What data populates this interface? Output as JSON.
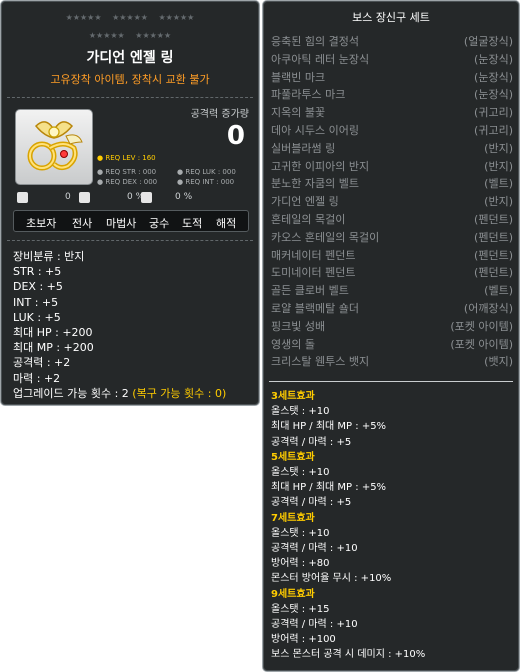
{
  "item": {
    "stars_row1": [
      "★★★★★",
      "★★★★★",
      "★★★★★"
    ],
    "stars_row2": [
      "★★★★★",
      "★★★★★"
    ],
    "name": "가디언 엔젤 링",
    "description": "고유장착 아이템, 장착시 교환 불가",
    "attack_label": "공격력 증가량",
    "attack_value": "0",
    "req_lev": "● REQ LEV : 160",
    "req_str": "● REQ STR : 000",
    "req_luk": "● REQ LUK : 000",
    "req_dex": "● REQ DEX : 000",
    "req_int": "● REQ INT : 000",
    "flags": [
      "0",
      "0 %",
      "0 %"
    ],
    "jobs": [
      "초보자",
      "전사",
      "마법사",
      "궁수",
      "도적",
      "해적"
    ],
    "stats": [
      "장비분류 : 반지",
      "STR : +5",
      "DEX : +5",
      "INT : +5",
      "LUK : +5",
      "최대 HP : +200",
      "최대 MP : +200",
      "공격력 : +2",
      "마력 : +2"
    ],
    "upgrade_label": "업그레이드 가능 횟수 : 2",
    "upgrade_recover": "(복구 가능 횟수 : 0)"
  },
  "set": {
    "title": "보스 장신구 세트",
    "items": [
      {
        "name": "응축된 힘의 결정석",
        "category": "(얼굴장식)"
      },
      {
        "name": "아쿠아틱 레터 눈장식",
        "category": "(눈장식)"
      },
      {
        "name": "블랙빈 마크",
        "category": "(눈장식)"
      },
      {
        "name": "파풀라투스 마크",
        "category": "(눈장식)"
      },
      {
        "name": "지옥의 불꽃",
        "category": "(귀고리)"
      },
      {
        "name": "데아 시두스 이어링",
        "category": "(귀고리)"
      },
      {
        "name": "실버블라썸 링",
        "category": "(반지)"
      },
      {
        "name": "고귀한 이피아의 반지",
        "category": "(반지)"
      },
      {
        "name": "분노한 자쿰의 벨트",
        "category": "(벨트)"
      },
      {
        "name": "가디언 엔젤 링",
        "category": "(반지)"
      },
      {
        "name": "혼테일의 목걸이",
        "category": "(펜던트)"
      },
      {
        "name": "카오스 혼테일의 목걸이",
        "category": "(펜던트)"
      },
      {
        "name": "매커네이터 펜던트",
        "category": "(펜던트)"
      },
      {
        "name": "도미네이터 펜던트",
        "category": "(펜던트)"
      },
      {
        "name": "골든 클로버 벨트",
        "category": "(벨트)"
      },
      {
        "name": "로얄 블랙메탈 숄더",
        "category": "(어깨장식)"
      },
      {
        "name": "핑크빛 성배",
        "category": "(포켓 아이템)"
      },
      {
        "name": "영생의 돌",
        "category": "(포켓 아이템)"
      },
      {
        "name": "크리스탈 웬투스 뱃지",
        "category": "(뱃지)"
      }
    ],
    "effects": [
      {
        "title": "3세트효과",
        "lines": [
          "올스탯 : +10",
          "최대 HP / 최대 MP : +5%",
          "공격력 / 마력 : +5"
        ]
      },
      {
        "title": "5세트효과",
        "lines": [
          "올스탯 : +10",
          "최대 HP / 최대 MP : +5%",
          "공격력 / 마력 : +5"
        ]
      },
      {
        "title": "7세트효과",
        "lines": [
          "올스탯 : +10",
          "공격력 / 마력 : +10",
          "방어력 : +80",
          "몬스터 방어율 무시 : +10%"
        ]
      },
      {
        "title": "9세트효과",
        "lines": [
          "올스탯 : +15",
          "공격력 / 마력 : +10",
          "방어력 : +100",
          "보스 몬스터 공격 시 데미지 : +10%"
        ]
      }
    ]
  },
  "colors": {
    "panel_bg": "#252829",
    "panel_border": "#9da4a8",
    "accent_orange": "#ff9d26",
    "accent_yellow": "#ffcc00",
    "muted_text": "#8c9093"
  },
  "icons": [
    "guardian-angel-ring-icon",
    "scissors-icon",
    "potential-icon",
    "shield-icon"
  ]
}
